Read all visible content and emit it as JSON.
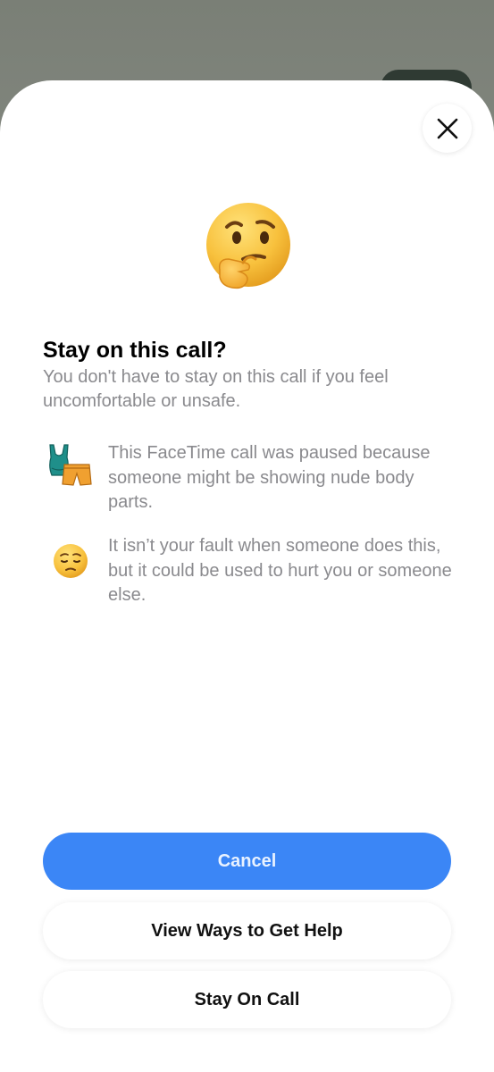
{
  "sheet": {
    "close_icon": "close-icon",
    "hero_icon": "thinking-face-icon",
    "title": "Stay on this call?",
    "subtitle": "You don't have to stay on this call if you feel uncomfortable or unsafe.",
    "items": [
      {
        "icon": "swimsuit-and-shorts-icon",
        "text": "This FaceTime call was paused because someone might be showing nude body parts."
      },
      {
        "icon": "pensive-face-icon",
        "text": "It isn’t your fault when someone does this, but it could be used to hurt you or someone else."
      }
    ]
  },
  "actions": {
    "cancel_label": "Cancel",
    "help_label": "View Ways to Get Help",
    "stay_label": "Stay On Call"
  },
  "colors": {
    "accent_blue": "#3b86f6",
    "secondary_text": "#8a8a8e",
    "emoji_yellow": "#f7c144"
  }
}
